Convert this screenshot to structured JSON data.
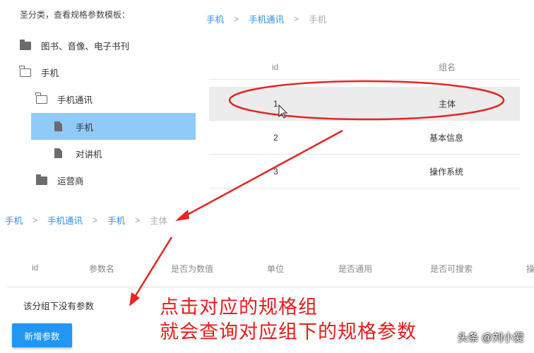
{
  "tree": {
    "hint": "圣分类，查看规格参数模板：",
    "items": [
      {
        "label": "图书、音像、电子书刊",
        "icon": "folder-icon"
      },
      {
        "label": "手机",
        "icon": "folder-open-icon"
      },
      {
        "label": "手机通讯",
        "icon": "folder-open-icon"
      },
      {
        "label": "手机",
        "icon": "file-icon",
        "selected": true
      },
      {
        "label": "对讲机",
        "icon": "file-icon"
      },
      {
        "label": "运营商",
        "icon": "folder-icon"
      }
    ]
  },
  "top_breadcrumb": [
    "手机",
    "手机通讯",
    "手机"
  ],
  "top_table": {
    "headers": [
      "id",
      "组名"
    ],
    "rows": [
      {
        "id": "1",
        "name": "主体"
      },
      {
        "id": "2",
        "name": "基本信息"
      },
      {
        "id": "3",
        "name": "操作系统"
      }
    ]
  },
  "bottom_breadcrumb": [
    "手机",
    "手机通讯",
    "手机",
    "主体"
  ],
  "bottom_table": {
    "headers": [
      "id",
      "参数名",
      "是否为数值",
      "单位",
      "是否通用",
      "是否可搜索",
      "操"
    ],
    "empty_message": "该分组下没有参数"
  },
  "add_button_label": "新增参数",
  "annotation": {
    "line1": "点击对应的规格组",
    "line2": "就会查询对应组下的规格参数"
  },
  "watermark": "头条 @刘小爱",
  "colors": {
    "link": "#2f8ee8",
    "selected": "#90caf9",
    "button": "#2196f3",
    "annotation": "#ea1b1b"
  }
}
